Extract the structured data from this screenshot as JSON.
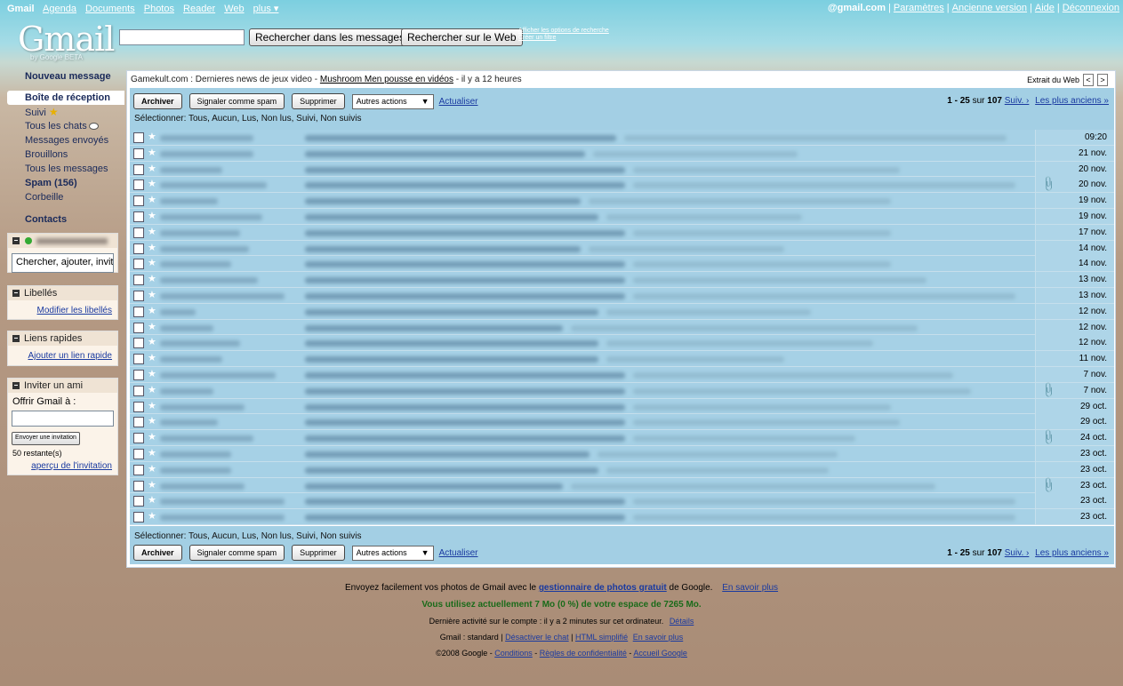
{
  "topbar": {
    "app": "Gmail",
    "links": [
      "Agenda",
      "Documents",
      "Photos",
      "Reader",
      "Web",
      "plus ▾"
    ],
    "account": "@gmail.com",
    "right_links": [
      "Paramètres",
      "Ancienne version",
      "Aide",
      "Déconnexion"
    ]
  },
  "logo": {
    "text": "Gmail",
    "beta": "by Google BETA"
  },
  "search": {
    "search_mail": "Rechercher dans les messages",
    "search_web": "Rechercher sur le Web",
    "options": "Afficher les options de recherche",
    "create_filter": "Créer un filtre"
  },
  "nav": {
    "compose": "Nouveau message",
    "items": [
      {
        "label": "Boîte de réception"
      },
      {
        "label": "Suivi"
      },
      {
        "label": "Tous les chats"
      },
      {
        "label": "Messages envoyés"
      },
      {
        "label": "Brouillons"
      },
      {
        "label": "Tous les messages"
      },
      {
        "label": "Spam (156)"
      },
      {
        "label": "Corbeille"
      }
    ],
    "contacts": "Contacts"
  },
  "chat": {
    "input": "Chercher, ajouter, invite"
  },
  "labels_box": {
    "title": "Libellés",
    "link": "Modifier les libellés"
  },
  "quick_links": {
    "title": "Liens rapides",
    "link": "Ajouter un lien rapide"
  },
  "invite": {
    "title": "Inviter un ami",
    "label": "Offrir Gmail à :",
    "button": "Envoyer une invitation",
    "remaining": "50 restante(s)",
    "preview": "aperçu de l'invitation"
  },
  "news": {
    "source": "Gamekult.com : Dernieres news de jeux video - ",
    "headline": "Mushroom Men pousse en vidéos",
    "age": " - il y a 12 heures",
    "web_clip": "Extrait du Web",
    "prev": "<",
    "next": ">"
  },
  "toolbar": {
    "archive": "Archiver",
    "spam": "Signaler comme spam",
    "delete": "Supprimer",
    "more": "Autres actions",
    "refresh": "Actualiser",
    "pager_range": "1 - 25",
    "pager_of": " sur ",
    "pager_total": "107",
    "next": "Suiv. ›",
    "oldest": "Les plus anciens »",
    "select_label": "Sélectionner: ",
    "select_options": "Tous, Aucun, Lus, Non lus, Suivi, Non suivis"
  },
  "emails": [
    {
      "date": "09:20",
      "attach": false
    },
    {
      "date": "21 nov.",
      "attach": false
    },
    {
      "date": "20 nov.",
      "attach": false
    },
    {
      "date": "20 nov.",
      "attach": true
    },
    {
      "date": "19 nov.",
      "attach": false
    },
    {
      "date": "19 nov.",
      "attach": false
    },
    {
      "date": "17 nov.",
      "attach": false
    },
    {
      "date": "14 nov.",
      "attach": false
    },
    {
      "date": "14 nov.",
      "attach": false
    },
    {
      "date": "13 nov.",
      "attach": false
    },
    {
      "date": "13 nov.",
      "attach": false
    },
    {
      "date": "12 nov.",
      "attach": false
    },
    {
      "date": "12 nov.",
      "attach": false
    },
    {
      "date": "12 nov.",
      "attach": false
    },
    {
      "date": "11 nov.",
      "attach": false
    },
    {
      "date": "7 nov.",
      "attach": false
    },
    {
      "date": "7 nov.",
      "attach": true
    },
    {
      "date": "29 oct.",
      "attach": false
    },
    {
      "date": "29 oct.",
      "attach": false
    },
    {
      "date": "24 oct.",
      "attach": true
    },
    {
      "date": "23 oct.",
      "attach": false
    },
    {
      "date": "23 oct.",
      "attach": false
    },
    {
      "date": "23 oct.",
      "attach": true
    },
    {
      "date": "23 oct.",
      "attach": false
    },
    {
      "date": "23 oct.",
      "attach": false
    }
  ],
  "footer": {
    "photos_pre": "Envoyez facilement vos photos de Gmail avec le ",
    "photos_link": "gestionnaire de photos gratuit",
    "photos_post": " de Google.",
    "learn_more": "En savoir plus",
    "storage": "Vous utilisez actuellement 7 Mo (0 %) de votre espace de 7265 Mo.",
    "activity": "Dernière activité sur le compte : il y a 2 minutes sur cet ordinateur.",
    "details": "Détails",
    "view_pre": "Gmail : standard | ",
    "disable_chat": "Désactiver le chat",
    "html_simple": "HTML simplifié",
    "learn_more2": "En savoir plus",
    "copyright": "©2008 Google - ",
    "conditions": "Conditions",
    "privacy": "Règles de confidentialité",
    "home": "Accueil Google"
  }
}
